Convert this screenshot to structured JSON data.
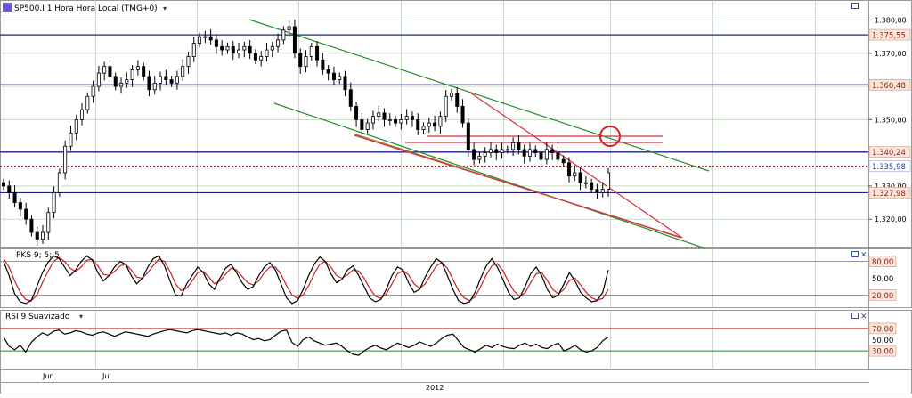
{
  "header": {
    "symbol": "SP500.I 1 Hora Hora Local (TMG+0)"
  },
  "colors": {
    "grid": "#a9c4a9",
    "horizontal_line": "#1f1f8f",
    "price_level": "#8b1a1a",
    "current_price": "#1f3f9f",
    "red_line": "#d83040",
    "green_line": "#2a8a2a",
    "brown_line": "#a07a30",
    "label_box": "#fbe5d8",
    "candle": "#000000",
    "indicator_black": "#000000",
    "indicator_red": "#cc2020"
  },
  "chart_data": [
    {
      "type": "candlestick",
      "title": "SP500.I 1 Hora Hora Local (TMG+0)",
      "xlabel": "2012",
      "x_ticks": [
        "Jun",
        "Jul"
      ],
      "y_ticks": [
        1320,
        1330,
        1340,
        1350,
        1360,
        1370,
        1380
      ],
      "y_tick_labels": [
        "1.320,00",
        "1.330,00",
        "1.340,00",
        "1.350,00",
        "1.360,00",
        "1.370,00",
        "1.380,00"
      ],
      "ylim": [
        1312,
        1385.5
      ],
      "horizontal_levels": [
        {
          "value": 1375.55,
          "label": "1.375,55"
        },
        {
          "value": 1360.48,
          "label": "1.360,48"
        },
        {
          "value": 1340.24,
          "label": "1.340,24"
        },
        {
          "value": 1327.98,
          "label": "1.327,98"
        }
      ],
      "current_price": {
        "value": 1335.98,
        "label": "1.335,98"
      },
      "close_series": [
        1330,
        1328,
        1325,
        1323,
        1320,
        1316,
        1314,
        1316,
        1322,
        1328,
        1334,
        1342,
        1346,
        1350,
        1353,
        1357,
        1360,
        1364,
        1366,
        1363,
        1360,
        1361,
        1362,
        1365,
        1366,
        1363,
        1359,
        1361,
        1363,
        1362,
        1361,
        1363,
        1366,
        1369,
        1373,
        1375,
        1375,
        1374,
        1372,
        1371,
        1372,
        1370,
        1371,
        1372,
        1370,
        1368,
        1369,
        1371,
        1372,
        1374,
        1377,
        1378,
        1370,
        1366,
        1369,
        1372,
        1368,
        1365,
        1364,
        1362,
        1363,
        1359,
        1354,
        1350,
        1347,
        1349,
        1351,
        1352,
        1350,
        1350,
        1349,
        1350,
        1351,
        1350,
        1347,
        1348,
        1349,
        1348,
        1351,
        1357,
        1358,
        1354,
        1349,
        1341,
        1338,
        1339,
        1340,
        1341,
        1340,
        1341,
        1341,
        1343,
        1341,
        1339,
        1341,
        1340,
        1338,
        1341,
        1340,
        1338,
        1337,
        1333,
        1334,
        1331,
        1331,
        1329,
        1328,
        1329,
        1334
      ]
    },
    {
      "type": "line",
      "name": "PKS 9; 5; 5",
      "ylim": [
        0,
        100
      ],
      "y_tick_labels": [
        "80,00",
        "50,00",
        "20,00"
      ],
      "reference_levels": [
        80,
        20
      ],
      "series": [
        {
          "name": "",
          "color": "black",
          "values": [
            80,
            55,
            22,
            8,
            5,
            10,
            35,
            60,
            78,
            90,
            85,
            70,
            55,
            65,
            80,
            90,
            82,
            60,
            45,
            55,
            70,
            80,
            75,
            55,
            40,
            50,
            70,
            85,
            90,
            72,
            45,
            20,
            18,
            40,
            55,
            70,
            60,
            40,
            30,
            50,
            68,
            75,
            60,
            42,
            30,
            35,
            55,
            70,
            78,
            65,
            40,
            15,
            5,
            10,
            30,
            55,
            75,
            88,
            80,
            58,
            42,
            48,
            65,
            72,
            55,
            35,
            15,
            8,
            12,
            30,
            55,
            70,
            65,
            42,
            25,
            30,
            52,
            70,
            85,
            78,
            55,
            30,
            10,
            5,
            8,
            25,
            50,
            72,
            85,
            70,
            48,
            25,
            12,
            15,
            35,
            58,
            70,
            55,
            30,
            15,
            20,
            40,
            60,
            45,
            25,
            15,
            8,
            10,
            25,
            65
          ]
        },
        {
          "name": "",
          "color": "red",
          "values": [
            85,
            70,
            45,
            25,
            12,
            10,
            20,
            42,
            62,
            80,
            87,
            80,
            68,
            62,
            70,
            82,
            84,
            72,
            57,
            55,
            62,
            72,
            75,
            65,
            52,
            50,
            60,
            73,
            84,
            80,
            62,
            40,
            28,
            32,
            45,
            60,
            62,
            52,
            40,
            45,
            57,
            68,
            65,
            53,
            42,
            38,
            45,
            60,
            70,
            70,
            57,
            37,
            20,
            14,
            20,
            37,
            58,
            75,
            80,
            70,
            55,
            50,
            56,
            65,
            63,
            50,
            32,
            18,
            14,
            22,
            40,
            58,
            64,
            56,
            40,
            32,
            40,
            56,
            72,
            78,
            68,
            48,
            28,
            15,
            10,
            17,
            35,
            56,
            72,
            76,
            64,
            44,
            27,
            18,
            24,
            42,
            58,
            60,
            46,
            30,
            22,
            30,
            46,
            50,
            38,
            25,
            15,
            11,
            14,
            30
          ]
        }
      ]
    },
    {
      "type": "line",
      "name": "RSI 9 Suavizado",
      "ylim": [
        0,
        100
      ],
      "y_tick_labels": [
        "70,00",
        "50,00",
        "30,00"
      ],
      "reference_levels": [
        70,
        30
      ],
      "series": [
        {
          "name": "",
          "color": "black",
          "values": [
            55,
            38,
            32,
            40,
            28,
            45,
            55,
            62,
            58,
            65,
            67,
            60,
            62,
            66,
            64,
            60,
            58,
            62,
            64,
            60,
            56,
            60,
            64,
            62,
            60,
            58,
            56,
            60,
            63,
            66,
            68,
            66,
            64,
            62,
            66,
            68,
            66,
            64,
            62,
            60,
            62,
            58,
            62,
            60,
            55,
            50,
            52,
            48,
            50,
            58,
            65,
            67,
            45,
            38,
            50,
            55,
            48,
            44,
            40,
            42,
            44,
            38,
            30,
            24,
            22,
            30,
            36,
            40,
            35,
            32,
            38,
            44,
            40,
            36,
            40,
            46,
            42,
            38,
            44,
            52,
            58,
            60,
            48,
            36,
            32,
            28,
            34,
            40,
            36,
            42,
            38,
            35,
            34,
            40,
            44,
            38,
            42,
            36,
            34,
            40,
            44,
            30,
            34,
            40,
            32,
            28,
            30,
            36,
            48,
            55
          ]
        }
      ]
    }
  ]
}
